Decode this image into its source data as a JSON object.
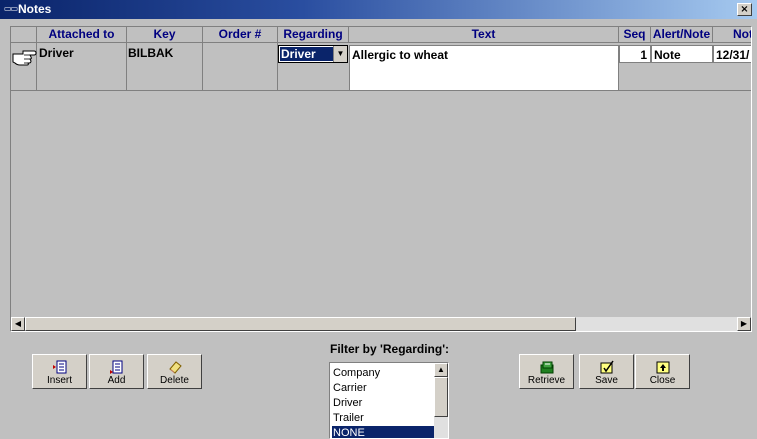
{
  "window": {
    "title": "Notes",
    "icon": "notes-app-icon",
    "close_glyph": "×"
  },
  "grid": {
    "columns": [
      "Attached to",
      "Key",
      "Order #",
      "Regarding",
      "Text",
      "Seq",
      "Alert/Note",
      "Not"
    ],
    "rows": [
      {
        "attached_to": "Driver",
        "key": "BILBAK",
        "order_no": "",
        "regarding": "Driver",
        "text": "Allergic to wheat",
        "seq": "1",
        "alert_note": "Note",
        "note_date": "12/31/"
      }
    ],
    "row_indicator_icon": "pointing-hand-icon"
  },
  "buttons": {
    "insert": "Insert",
    "add": "Add",
    "delete": "Delete",
    "retrieve": "Retrieve",
    "save": "Save",
    "close": "Close"
  },
  "filter": {
    "label": "Filter by 'Regarding':",
    "options": [
      "Company",
      "Carrier",
      "Driver",
      "Trailer",
      "NONE"
    ],
    "selected": "NONE"
  },
  "colors": {
    "header_text": "#000080",
    "selection": "#0a246a",
    "window_bg": "#c0c0c0"
  }
}
